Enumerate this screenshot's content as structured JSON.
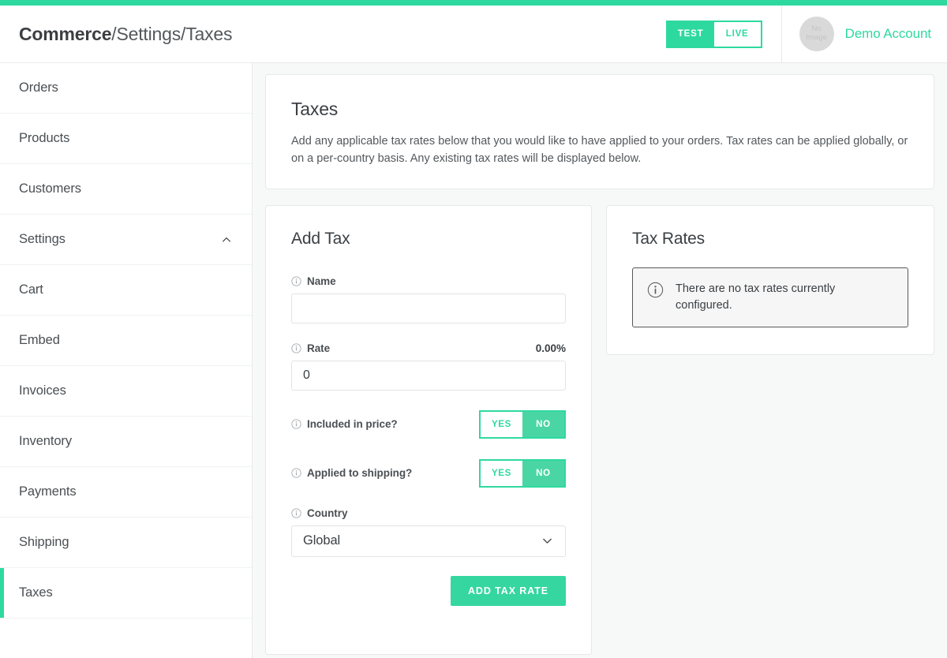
{
  "header": {
    "breadcrumb": {
      "root": "Commerce",
      "separator": "/",
      "level1": "Settings",
      "level2": "Taxes"
    },
    "env_toggle": {
      "test_label": "TEST",
      "live_label": "LIVE",
      "active": "TEST"
    },
    "account": {
      "avatar_line1": "No",
      "avatar_line2": "Image",
      "name": "Demo Account"
    }
  },
  "sidebar": {
    "items": [
      {
        "label": "Orders",
        "active": false,
        "expandable": false
      },
      {
        "label": "Products",
        "active": false,
        "expandable": false
      },
      {
        "label": "Customers",
        "active": false,
        "expandable": false
      },
      {
        "label": "Settings",
        "active": false,
        "expandable": true
      },
      {
        "label": "Cart",
        "active": false,
        "expandable": false
      },
      {
        "label": "Embed",
        "active": false,
        "expandable": false
      },
      {
        "label": "Invoices",
        "active": false,
        "expandable": false
      },
      {
        "label": "Inventory",
        "active": false,
        "expandable": false
      },
      {
        "label": "Payments",
        "active": false,
        "expandable": false
      },
      {
        "label": "Shipping",
        "active": false,
        "expandable": false
      },
      {
        "label": "Taxes",
        "active": true,
        "expandable": false
      }
    ]
  },
  "intro": {
    "title": "Taxes",
    "description": "Add any applicable tax rates below that you would like to have applied to your orders. Tax rates can be applied globally, or on a per-country basis. Any existing tax rates will be displayed below."
  },
  "add_tax": {
    "title": "Add Tax",
    "name_field": {
      "label": "Name",
      "value": "",
      "placeholder": ""
    },
    "rate_field": {
      "label": "Rate",
      "value": "0",
      "display_value": "0.00%"
    },
    "included_in_price": {
      "label": "Included in price?",
      "yes_label": "YES",
      "no_label": "NO",
      "selected": "NO"
    },
    "applied_to_shipping": {
      "label": "Applied to shipping?",
      "yes_label": "YES",
      "no_label": "NO",
      "selected": "NO"
    },
    "country_field": {
      "label": "Country",
      "selected": "Global"
    },
    "submit_label": "ADD TAX RATE"
  },
  "tax_rates": {
    "title": "Tax Rates",
    "empty_message": "There are no tax rates currently configured."
  },
  "colors": {
    "accent": "#2ed9a0",
    "accent_button": "#35d6a0",
    "page_bg": "#f7f8f8",
    "card_bg": "#ffffff",
    "text": "#3b3f43",
    "muted_text": "#53585c",
    "border": "#e6e8e9"
  }
}
